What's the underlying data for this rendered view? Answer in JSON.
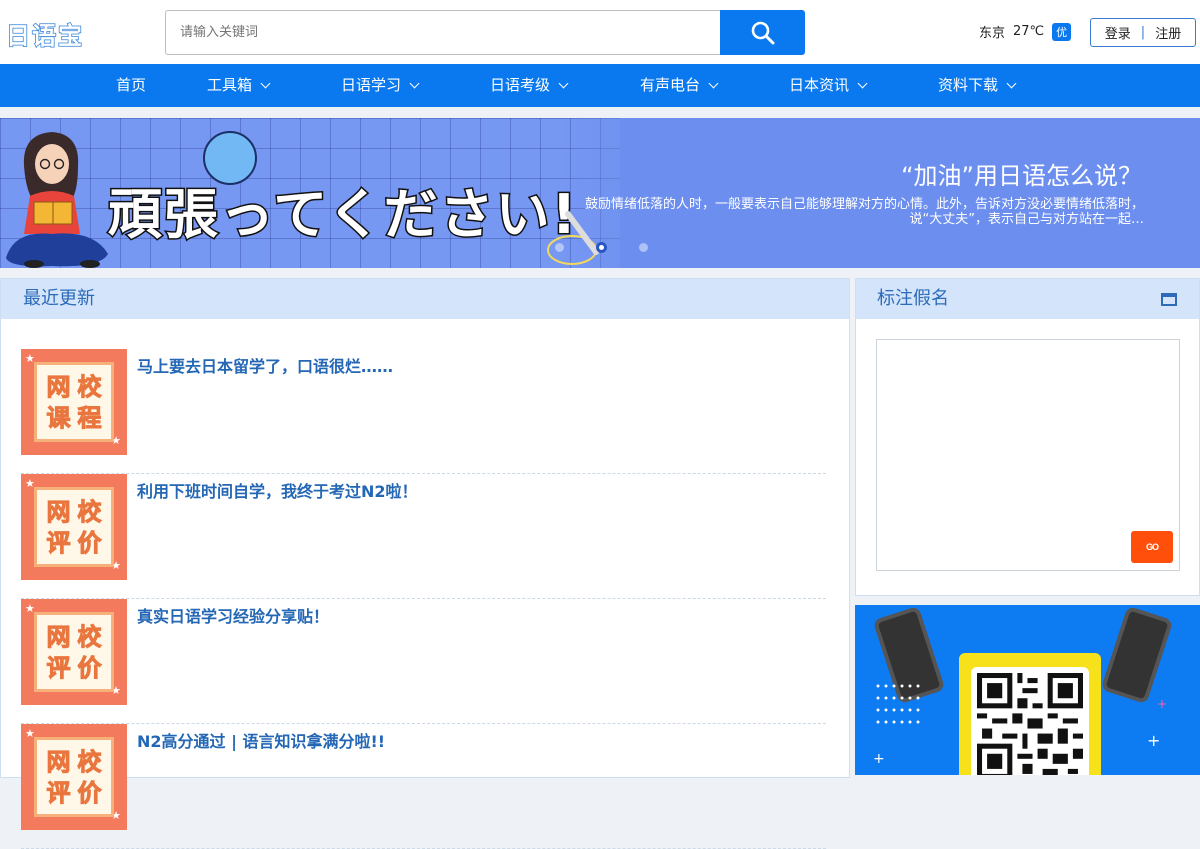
{
  "header": {
    "logo": "日语宝",
    "search_placeholder": "请输入关键词",
    "weather": {
      "city": "东京",
      "temp": "27℃",
      "air_quality": "优"
    },
    "auth": {
      "login": "登录",
      "separator": "|",
      "register": "注册"
    }
  },
  "nav": {
    "items": [
      {
        "label": "首页",
        "has_dropdown": false
      },
      {
        "label": "工具箱",
        "has_dropdown": true
      },
      {
        "label": "日语学习",
        "has_dropdown": true
      },
      {
        "label": "日语考级",
        "has_dropdown": true
      },
      {
        "label": "有声电台",
        "has_dropdown": true
      },
      {
        "label": "日本资讯",
        "has_dropdown": true
      },
      {
        "label": "资料下载",
        "has_dropdown": true
      }
    ]
  },
  "banner": {
    "headline_jp": "頑張ってください!",
    "title": "“加油”用日语怎么说？",
    "description": "鼓励情绪低落的人时，一般要表示自己能够理解对方的心情。此外，告诉对方没必要情绪低落时，说“大丈夫”，表示自己与对方站在一起…",
    "slide_count": 3,
    "active_slide": 2
  },
  "recent": {
    "heading": "最近更新",
    "items": [
      {
        "title": "马上要去日本留学了，口语很烂……",
        "thumb": [
          "网",
          "校",
          "课",
          "程"
        ]
      },
      {
        "title": "利用下班时间自学，我终于考过N2啦！",
        "thumb": [
          "网",
          "校",
          "评",
          "价"
        ]
      },
      {
        "title": "真实日语学习经验分享贴！",
        "thumb": [
          "网",
          "校",
          "评",
          "价"
        ]
      },
      {
        "title": "N2高分通过 | 语言知识拿满分啦!!",
        "thumb": [
          "网",
          "校",
          "评",
          "价"
        ]
      }
    ]
  },
  "kana": {
    "heading": "标注假名",
    "go_label": "GO"
  },
  "colors": {
    "primary": "#0a79f0",
    "panel_head": "#d3e4fb",
    "go_button": "#ff4f0b",
    "thumb_bg": "#f47a5e"
  }
}
